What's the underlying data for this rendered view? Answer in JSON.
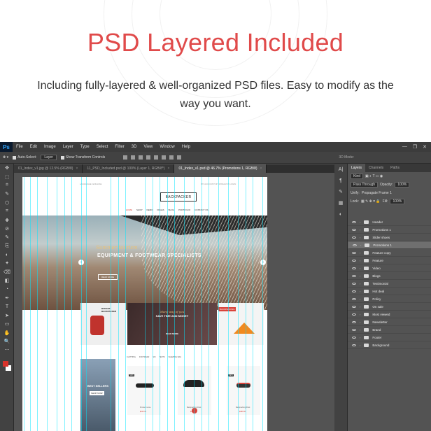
{
  "hero": {
    "title": "PSD Layered Included",
    "subtitle": "Including fully-layered & well-organized PSD files.  Easy to modify as the way you want."
  },
  "app": {
    "logo": "Ps",
    "menus": [
      "File",
      "Edit",
      "Image",
      "Layer",
      "Type",
      "Select",
      "Filter",
      "3D",
      "View",
      "Window",
      "Help"
    ],
    "window_controls": [
      "—",
      "❐",
      "✕"
    ],
    "options": {
      "auto_select": "Auto-Select:",
      "layer_select": "Layer",
      "transform": "Show Transform Controls",
      "mode3d": "3D Mode:"
    },
    "tabs": [
      {
        "label": "01_Index_v1.jpg @ 12.5% (RGB/8)",
        "active": false
      },
      {
        "label": "11_PSD_Included.psd @ 100% (Layer 1, RGB/8*)",
        "active": false
      },
      {
        "label": "01_Index_v1.psd @ 46.7% (Promotions 1, RGB/8)",
        "active": true
      }
    ],
    "tools": [
      "✥",
      "⬚",
      "⌾",
      "✎",
      "⬡",
      "⌗",
      "✚",
      "⊘",
      "✎",
      "⎘",
      "◐",
      "✦",
      "⌫",
      "◧",
      "◔",
      "✒",
      "T",
      "➤",
      "▭",
      "✋",
      "🔍",
      "⋯"
    ],
    "colors": {
      "foreground": "#d9332b",
      "background": "#ffffff",
      "guide": "#00e6ff",
      "panel": "#535353"
    },
    "panel": {
      "tabs": [
        {
          "label": "Layers",
          "active": true
        },
        {
          "label": "Channels",
          "active": false
        },
        {
          "label": "Paths",
          "active": false
        }
      ],
      "kind": "Kind",
      "blend": "Pass Through",
      "opacity_label": "Opacity:",
      "opacity": "100%",
      "lock_label": "Lock:",
      "fill_label": "Fill:",
      "fill": "100%",
      "propagate": "Propagate Frame 1",
      "unify": "Unify:",
      "layers": [
        {
          "name": "Header",
          "selected": false
        },
        {
          "name": "Promotions 1",
          "selected": false
        },
        {
          "name": "Slider shoes",
          "selected": false
        },
        {
          "name": "Promotions 1",
          "selected": true
        },
        {
          "name": "Feature copy",
          "selected": false
        },
        {
          "name": "Feature",
          "selected": false
        },
        {
          "name": "Video",
          "selected": false
        },
        {
          "name": "Blogs",
          "selected": false
        },
        {
          "name": "Testimonial",
          "selected": false
        },
        {
          "name": "Hot deal",
          "selected": false
        },
        {
          "name": "Policy",
          "selected": false
        },
        {
          "name": "On sale",
          "selected": false
        },
        {
          "name": "Most viewed",
          "selected": false
        },
        {
          "name": "Newsletter",
          "selected": false
        },
        {
          "name": "Brand",
          "selected": false
        },
        {
          "name": "Footer",
          "selected": false
        },
        {
          "name": "Background",
          "selected": false
        }
      ]
    }
  },
  "site": {
    "topleft": "LANGUAGE: ENGLISH",
    "topright": "MY ACCOUNT   MY WISHLIST   LOGIN",
    "logo": "BACKPACKER",
    "nav": [
      {
        "label": "HOME",
        "active": true
      },
      {
        "label": "SHOP",
        "active": false
      },
      {
        "label": "DEMO",
        "active": false
      },
      {
        "label": "PAGES",
        "active": false
      },
      {
        "label": "BLOG",
        "active": false
      },
      {
        "label": "PORTFOLIO",
        "active": false
      },
      {
        "label": "CONTACT US",
        "active": false
      }
    ],
    "slider": {
      "script": "Summer tourism",
      "headline": "EQUIPMENT & FOOTWEAR SPECIALISTS",
      "button": "READ MORE"
    },
    "banners": {
      "left_tag": "BUDGET BACKPACKER",
      "center_script": "Many way of you",
      "center_title": "SAVE TIME AND MONEY",
      "center_btn": "READ MORE",
      "right_tag": "BACKPACKING"
    },
    "product_tabs": [
      "CLOTHING",
      "FOOTWEAR",
      "SKI",
      "TENTS",
      "SLEEPING BAG"
    ],
    "best": {
      "title": "BEST SELLERS",
      "button": "SHOP NOW"
    },
    "products": [
      {
        "badge": "NEW",
        "name": "Product name",
        "price": "$210.00"
      },
      {
        "badge": "",
        "name": "Backpacking Pack",
        "price": "$199.00"
      },
      {
        "badge": "NEW",
        "name": "Backpacking Pack",
        "price": "$399.00"
      }
    ]
  }
}
